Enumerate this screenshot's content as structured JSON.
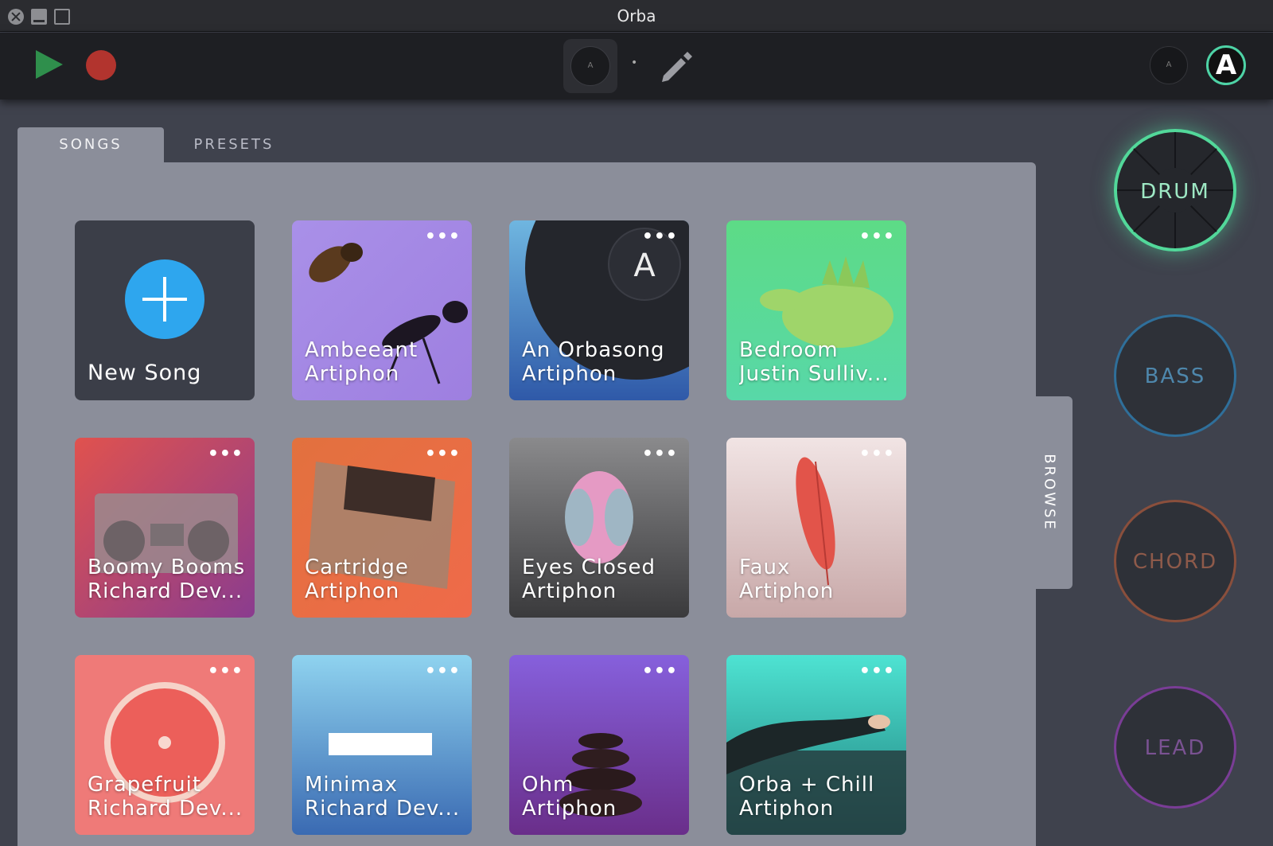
{
  "window": {
    "title": "Orba"
  },
  "tabs": [
    {
      "label": "SONGS",
      "active": true
    },
    {
      "label": "PRESETS",
      "active": false
    }
  ],
  "browse_label": "BROWSE",
  "new_song": {
    "label": "New Song"
  },
  "songs": [
    {
      "name": "Ambeeant",
      "author": "Artiphon"
    },
    {
      "name": "An Orbasong",
      "author": "Artiphon"
    },
    {
      "name": "Bedroom",
      "author": "Justin Sulliv..."
    },
    {
      "name": "Boomy Booms",
      "author": "Richard Dev..."
    },
    {
      "name": "Cartridge",
      "author": "Artiphon"
    },
    {
      "name": "Eyes Closed",
      "author": "Artiphon"
    },
    {
      "name": "Faux",
      "author": "Artiphon"
    },
    {
      "name": "Grapefruit",
      "author": "Richard Dev..."
    },
    {
      "name": "Minimax",
      "author": "Richard Dev..."
    },
    {
      "name": "Ohm",
      "author": "Artiphon"
    },
    {
      "name": "Orba + Chill",
      "author": "Artiphon"
    }
  ],
  "more_glyph": "•••",
  "instruments": {
    "drum": "DRUM",
    "bass": "BASS",
    "chord": "CHORD",
    "lead": "LEAD"
  },
  "device_glyph": "A",
  "avatar_glyph": "A",
  "colors": {
    "play": "#2f8f4c",
    "record": "#b2342e",
    "drum": "#52d89a",
    "bass": "#2f6f9a",
    "chord": "#8a4f3c",
    "lead": "#7a3d96",
    "new_song_plus": "#2ea6ee"
  }
}
